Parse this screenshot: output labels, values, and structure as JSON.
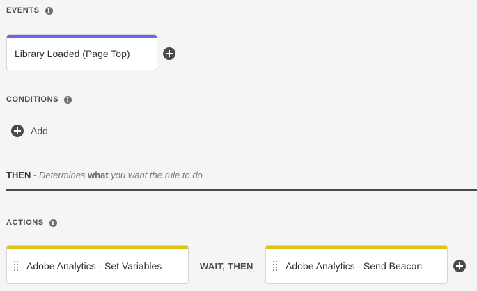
{
  "events": {
    "heading": "EVENTS",
    "info_glyph": "i",
    "cards": [
      {
        "label": "Library Loaded (Page Top)",
        "accent_color": "#6767ec"
      }
    ]
  },
  "conditions": {
    "heading": "CONDITIONS",
    "info_glyph": "i",
    "add_label": "Add"
  },
  "then": {
    "prefix": "THEN",
    "dash": " - ",
    "text_before": "Determines ",
    "text_bold": "what",
    "text_after": " you want the rule to do"
  },
  "actions": {
    "heading": "ACTIONS",
    "info_glyph": "i",
    "accent_color": "#e0c412",
    "cards": [
      {
        "label": "Adobe Analytics - Set Variables"
      },
      {
        "label": "Adobe Analytics - Send Beacon"
      }
    ],
    "sequence_label": "WAIT, THEN"
  }
}
